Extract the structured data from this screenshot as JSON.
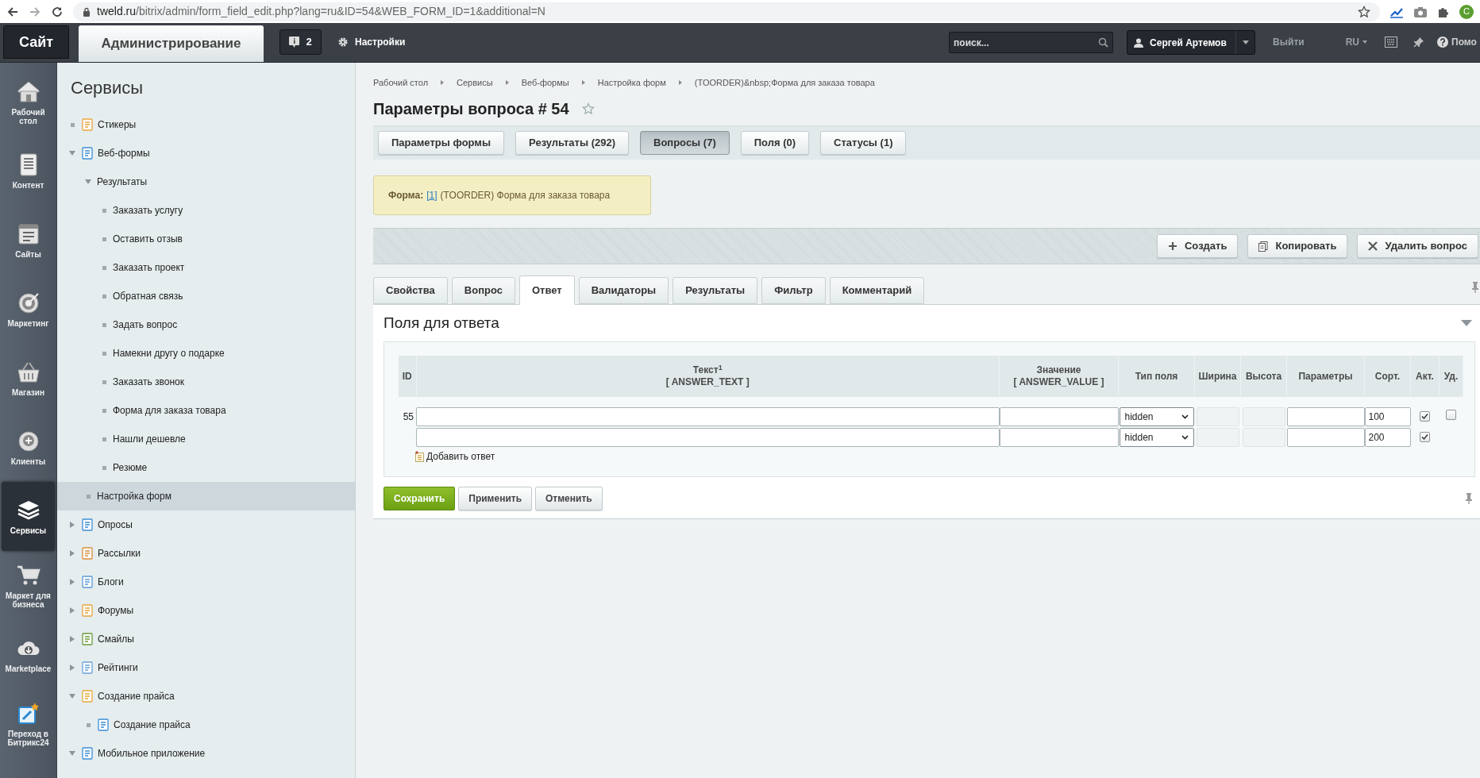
{
  "browser": {
    "url_host": "tweld.ru",
    "url_path": "/bitrix/admin/form_field_edit.php?lang=ru&ID=54&WEB_FORM_ID=1&additional=N",
    "profile_initial": "C"
  },
  "top_bar": {
    "site_button": "Сайт",
    "admin_tab": "Администрирование",
    "notifications": "2",
    "settings": "Настройки",
    "search_placeholder": "поиск...",
    "user": "Сергей Артемов",
    "logout": "Выйти",
    "language": "RU",
    "help": "Помо"
  },
  "left_nav": [
    {
      "label": "Рабочий стол",
      "selected": false
    },
    {
      "label": "Контент",
      "selected": false
    },
    {
      "label": "Сайты",
      "selected": false
    },
    {
      "label": "Маркетинг",
      "selected": false
    },
    {
      "label": "Магазин",
      "selected": false
    },
    {
      "label": "Клиенты",
      "selected": false
    },
    {
      "label": "Сервисы",
      "selected": true
    },
    {
      "label": "Маркет для бизнеса",
      "selected": false
    },
    {
      "label": "Marketplace",
      "selected": false
    },
    {
      "label": "Переход в Битрикс24",
      "selected": false
    }
  ],
  "tree": {
    "title": "Сервисы",
    "items": [
      {
        "label": "Стикеры",
        "kind": "module",
        "selected": false
      },
      {
        "label": "Веб-формы",
        "kind": "module",
        "expanded": true,
        "selected": false,
        "children": [
          {
            "label": "Результаты",
            "kind": "link",
            "expanded": true,
            "selected": false,
            "children": [
              {
                "label": "Заказать услугу",
                "kind": "link",
                "selected": false
              },
              {
                "label": "Оставить отзыв",
                "kind": "link",
                "selected": false
              },
              {
                "label": "Заказать проект",
                "kind": "link",
                "selected": false
              },
              {
                "label": "Обратная связь",
                "kind": "link",
                "selected": false
              },
              {
                "label": "Задать вопрос",
                "kind": "link",
                "selected": false
              },
              {
                "label": "Намекни другу о подарке",
                "kind": "link",
                "selected": false
              },
              {
                "label": "Заказать звонок",
                "kind": "link",
                "selected": false
              },
              {
                "label": "Форма для заказа товара",
                "kind": "link",
                "selected": false
              },
              {
                "label": "Нашли дешевле",
                "kind": "link",
                "selected": false
              },
              {
                "label": "Резюме",
                "kind": "link",
                "selected": false
              }
            ]
          },
          {
            "label": "Настройка форм",
            "kind": "link",
            "selected": true
          }
        ]
      },
      {
        "label": "Опросы",
        "kind": "module",
        "expanded": false,
        "selected": false
      },
      {
        "label": "Рассылки",
        "kind": "module",
        "expanded": false,
        "selected": false
      },
      {
        "label": "Блоги",
        "kind": "module",
        "expanded": false,
        "selected": false
      },
      {
        "label": "Форумы",
        "kind": "module",
        "expanded": false,
        "selected": false
      },
      {
        "label": "Смайлы",
        "kind": "module",
        "expanded": false,
        "selected": false
      },
      {
        "label": "Рейтинги",
        "kind": "module",
        "expanded": false,
        "selected": false
      },
      {
        "label": "Создание прайса",
        "kind": "module",
        "expanded": true,
        "selected": false,
        "children": [
          {
            "label": "Создание прайса",
            "kind": "module",
            "selected": false
          }
        ]
      },
      {
        "label": "Мобильное приложение",
        "kind": "module",
        "expanded": true,
        "selected": false
      }
    ]
  },
  "breadcrumbs": [
    "Рабочий стол",
    "Сервисы",
    "Веб-формы",
    "Настройка форм",
    "(TOORDER)&nbsp;Форма для заказа товара"
  ],
  "page_title": "Параметры вопроса # 54",
  "form_tabs": [
    {
      "label": "Параметры формы",
      "selected": false
    },
    {
      "label": "Результаты (292)",
      "selected": false
    },
    {
      "label": "Вопросы (7)",
      "selected": true
    },
    {
      "label": "Поля (0)",
      "selected": false
    },
    {
      "label": "Статусы (1)",
      "selected": false
    }
  ],
  "notice": {
    "label": "Форма:",
    "link": "[1]",
    "text": "(TOORDER) Форма для заказа товара"
  },
  "toolbar": [
    {
      "kind": "create",
      "label": "Создать"
    },
    {
      "kind": "copy",
      "label": "Копировать"
    },
    {
      "kind": "delete",
      "label": "Удалить вопрос"
    }
  ],
  "sub_tabs": [
    {
      "label": "Свойства",
      "selected": false
    },
    {
      "label": "Вопрос",
      "selected": false
    },
    {
      "label": "Ответ",
      "selected": true
    },
    {
      "label": "Валидаторы",
      "selected": false
    },
    {
      "label": "Результаты",
      "selected": false
    },
    {
      "label": "Фильтр",
      "selected": false
    },
    {
      "label": "Комментарий",
      "selected": false
    }
  ],
  "section": {
    "title": "Поля для ответа",
    "expanded": true
  },
  "table": {
    "columns": [
      {
        "label": "ID"
      },
      {
        "label": "Текст$^{1}$",
        "sublabel": "[ ANSWER_TEXT ]"
      },
      {
        "label": "Значение",
        "sublabel": "[ ANSWER_VALUE ]"
      },
      {
        "label": "Тип поля"
      },
      {
        "label": "Ширина"
      },
      {
        "label": "Высота"
      },
      {
        "label": "Параметры"
      },
      {
        "label": "Сорт."
      },
      {
        "label": "Акт."
      },
      {
        "label": "Уд."
      }
    ],
    "rows": [
      {
        "id": "55",
        "field_type": "hidden",
        "sizes_disabled": true,
        "sort": "100",
        "active": true,
        "delete": false
      },
      {
        "field_type": "hidden",
        "sizes_disabled": true,
        "sort": "200",
        "active": true
      }
    ],
    "add_answer": "Добавить ответ"
  },
  "buttons": [
    {
      "kind": "primary",
      "label": "Сохранить"
    },
    {
      "kind": "normal",
      "label": "Применить"
    },
    {
      "kind": "normal",
      "label": "Отменить"
    }
  ]
}
